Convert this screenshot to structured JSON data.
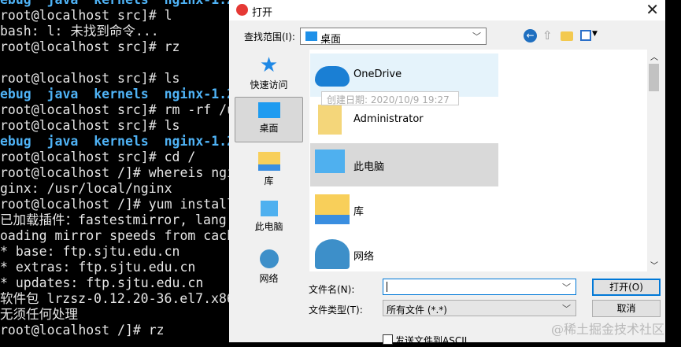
{
  "terminal": {
    "lines": [
      {
        "t": "ebug  java  kernels  nginx-1.2",
        "bold": true
      },
      {
        "t": "root@localhost src]# l"
      },
      {
        "t": "bash: l: 未找到命令..."
      },
      {
        "t": "root@localhost src]# rz"
      },
      {
        "t": ""
      },
      {
        "t": "root@localhost src]# ls"
      },
      {
        "t": "ebug  java  kernels  nginx-1.2",
        "bold": true
      },
      {
        "t": "root@localhost src]# rm -rf /u"
      },
      {
        "t": "root@localhost src]# ls"
      },
      {
        "t": "ebug  java  kernels  nginx-1.2",
        "bold": true
      },
      {
        "t": "root@localhost src]# cd /"
      },
      {
        "t": "root@localhost /]# whereis ngi"
      },
      {
        "t": "ginx: /usr/local/nginx"
      },
      {
        "t": "root@localhost /]# yum install"
      },
      {
        "t": "已加载插件：fastestmirror, lang"
      },
      {
        "t": "oading mirror speeds from cach"
      },
      {
        "t": "* base: ftp.sjtu.edu.cn"
      },
      {
        "t": "* extras: ftp.sjtu.edu.cn"
      },
      {
        "t": "* updates: ftp.sjtu.edu.cn"
      },
      {
        "t": "软件包 lrzsz-0.12.20-36.el7.x86"
      },
      {
        "t": "无须任何处理"
      },
      {
        "t": "root@localhost /]# rz"
      }
    ]
  },
  "dialog": {
    "title": "打开",
    "look_in_label": "查找范围(I):",
    "look_in_value": "桌面",
    "sidebar": [
      "快速访问",
      "桌面",
      "库",
      "此电脑",
      "网络"
    ],
    "files": [
      "OneDrive",
      "Administrator",
      "此电脑",
      "库",
      "网络"
    ],
    "tooltip": "创建日期: 2020/10/9 19:27",
    "filename_label": "文件名(N):",
    "filename_value": "",
    "filetype_label": "文件类型(T):",
    "filetype_value": "所有文件 (*.*)",
    "open_button": "打开(O)",
    "cancel_button": "取消",
    "ascii_checkbox": "发送文件到ASCII",
    "ascii_checked": false
  },
  "watermark": "@稀土掘金技术社区"
}
